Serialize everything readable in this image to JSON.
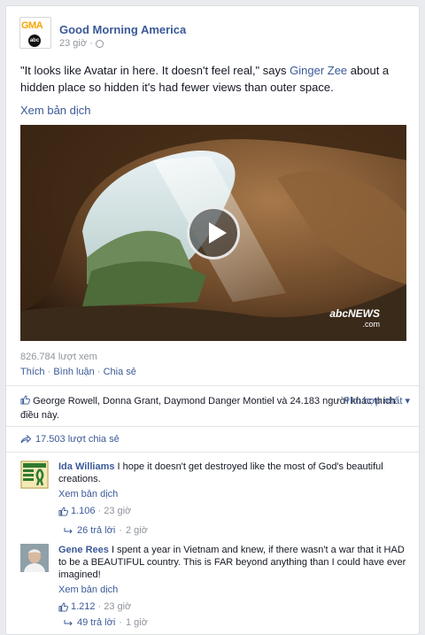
{
  "post": {
    "page_name": "Good Morning America",
    "logo_text": "GMA",
    "time": "23 giờ",
    "sep": "·",
    "text_before": "\"It looks like Avatar in here. It doesn't feel real,\" says ",
    "text_link": "Ginger Zee",
    "text_after": " about a hidden place so hidden it's had fewer views than outer space.",
    "translate": "Xem bản dịch",
    "video_brand": "abcNEWS",
    "video_brand_sub": ".com",
    "views": "826.784 lượt xem",
    "actions": [
      "Thích",
      "Bình luận",
      "Chia sẻ"
    ],
    "action_sep": "·"
  },
  "likes": {
    "names": "George Rowell, Donna Grant, Daymond Danger Montiel và 24.183 người khác thích điều này.",
    "sort": "Phù hợp nhất"
  },
  "shares": {
    "label": "17.503 lượt chia sẻ"
  },
  "comments": [
    {
      "author": "Ida Williams",
      "text": "I hope it doesn't get destroyed like the most of God's beautiful creations.",
      "translate": "Xem bản dịch",
      "likes": "1.106",
      "time": "23 giờ",
      "replies": "26 trả lời",
      "replies_time": "2 giờ"
    },
    {
      "author": "Gene Rees",
      "text": "I spent a year in Vietnam and knew, if there wasn't a war that it HAD to be a BEAUTIFUL country. This is FAR beyond anything than I could have ever imagined!",
      "translate": "Xem bản dịch",
      "likes": "1.212",
      "time": "23 giờ",
      "replies": "49 trả lời",
      "replies_time": "1 giờ"
    }
  ],
  "colors": {
    "link": "#3b5998",
    "muted": "#90949c",
    "text": "#141823",
    "background": "#e9ebee"
  }
}
